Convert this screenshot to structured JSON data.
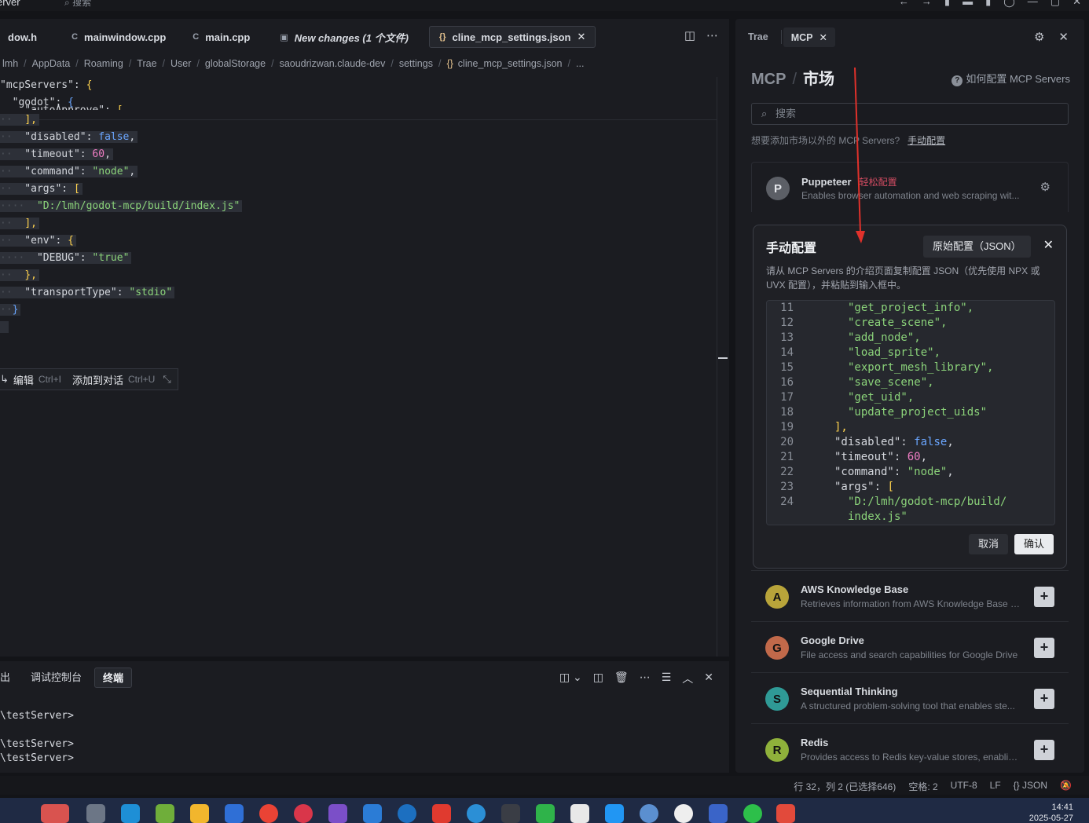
{
  "titlebar": {
    "app_fragment": "erver",
    "search_placeholder": "搜索"
  },
  "editor": {
    "tabs": [
      {
        "label": "dow.h",
        "icon": ""
      },
      {
        "label": "mainwindow.cpp",
        "icon": "C"
      },
      {
        "label": "main.cpp",
        "icon": "C"
      },
      {
        "label": "New changes (1 个文件)",
        "icon": "▣"
      },
      {
        "label": "cline_mcp_settings.json",
        "icon": "{}"
      }
    ],
    "breadcrumb": [
      "lmh",
      "AppData",
      "Roaming",
      "Trae",
      "User",
      "globalStorage",
      "saoudrizwan.claude-dev",
      "settings",
      "cline_mcp_settings.json",
      "..."
    ],
    "code": {
      "l1_key": "mcpServers",
      "l2_key": "godot",
      "l3_fragment": "autoApprove",
      "disabled_key": "disabled",
      "disabled_val": "false",
      "timeout_key": "timeout",
      "timeout_val": "60",
      "command_key": "command",
      "command_val": "node",
      "args_key": "args",
      "args_val": "D:/lmh/godot-mcp/build/index.js",
      "env_key": "env",
      "debug_key": "DEBUG",
      "debug_val": "true",
      "transport_key": "transportType",
      "transport_val": "stdio"
    },
    "inline_actions": {
      "edit_label": "编辑",
      "edit_kb": "Ctrl+I",
      "add_label": "添加到对话",
      "add_kb": "Ctrl+U"
    }
  },
  "panel": {
    "tabs": [
      "出",
      "调试控制台",
      "终端"
    ],
    "terminal_lines": [
      "\\testServer>",
      "\\testServer>",
      "\\testServer>"
    ]
  },
  "statusbar": {
    "position": "行 32，列 2 (已选择646)",
    "indent": "空格: 2",
    "encoding": "UTF-8",
    "eol": "LF",
    "language": "JSON"
  },
  "taskbar": {
    "time": "14:41",
    "date": "2025-05-27"
  },
  "sidepanel": {
    "tabs": [
      "Trae",
      "MCP"
    ],
    "title_left": "MCP",
    "title_right": "市场",
    "help_link": "如何配置 MCP Servers",
    "search_placeholder": "搜索",
    "hint_text": "想要添加市场以外的 MCP Servers?",
    "hint_link": "手动配置",
    "servers": [
      {
        "initial": "P",
        "name": "Puppeteer",
        "tag": "轻松配置",
        "desc": "Enables browser automation and web scraping wit...",
        "color": "#5c5f66"
      },
      {
        "initial": "A",
        "name": "AWS Knowledge Base",
        "tag": "",
        "desc": "Retrieves information from AWS Knowledge Base u...",
        "color": "#b8a43a"
      },
      {
        "initial": "G",
        "name": "Google Drive",
        "tag": "",
        "desc": "File access and search capabilities for Google Drive",
        "color": "#c1694a"
      },
      {
        "initial": "S",
        "name": "Sequential Thinking",
        "tag": "",
        "desc": "A structured problem-solving tool that enables ste...",
        "color": "#2f9a96"
      },
      {
        "initial": "R",
        "name": "Redis",
        "tag": "",
        "desc": "Provides access to Redis key-value stores, enabling...",
        "color": "#8fb13b"
      }
    ]
  },
  "modal": {
    "title": "手动配置",
    "raw_button": "原始配置（JSON）",
    "desc": "请从 MCP Servers 的介绍页面复制配置 JSON（优先使用 NPX 或 UVX 配置），并粘贴到输入框中。",
    "lines": [
      {
        "n": "11",
        "text": "\"get_project_info\",",
        "type": "s",
        "indent": 3
      },
      {
        "n": "12",
        "text": "\"create_scene\",",
        "type": "s",
        "indent": 3
      },
      {
        "n": "13",
        "text": "\"add_node\",",
        "type": "s",
        "indent": 3
      },
      {
        "n": "14",
        "text": "\"load_sprite\",",
        "type": "s",
        "indent": 3
      },
      {
        "n": "15",
        "text": "\"export_mesh_library\",",
        "type": "s",
        "indent": 3
      },
      {
        "n": "16",
        "text": "\"save_scene\",",
        "type": "s",
        "indent": 3
      },
      {
        "n": "17",
        "text": "\"get_uid\",",
        "type": "s",
        "indent": 3
      },
      {
        "n": "18",
        "text": "\"update_project_uids\"",
        "type": "s",
        "indent": 3
      },
      {
        "n": "19",
        "text": "],",
        "type": "p",
        "indent": 2
      },
      {
        "n": "20",
        "text": "\"disabled\": false,",
        "type": "kb",
        "indent": 2
      },
      {
        "n": "21",
        "text": "\"timeout\": 60,",
        "type": "kn",
        "indent": 2
      },
      {
        "n": "22",
        "text": "\"command\": \"node\",",
        "type": "ks",
        "indent": 2
      },
      {
        "n": "23",
        "text": "\"args\": [",
        "type": "kp",
        "indent": 2
      },
      {
        "n": "24",
        "text": "\"D:/lmh/godot-mcp/build/",
        "type": "s",
        "indent": 3
      },
      {
        "n": "",
        "text": "index.js\"",
        "type": "s",
        "indent": 3
      }
    ],
    "cancel": "取消",
    "confirm": "确认"
  }
}
